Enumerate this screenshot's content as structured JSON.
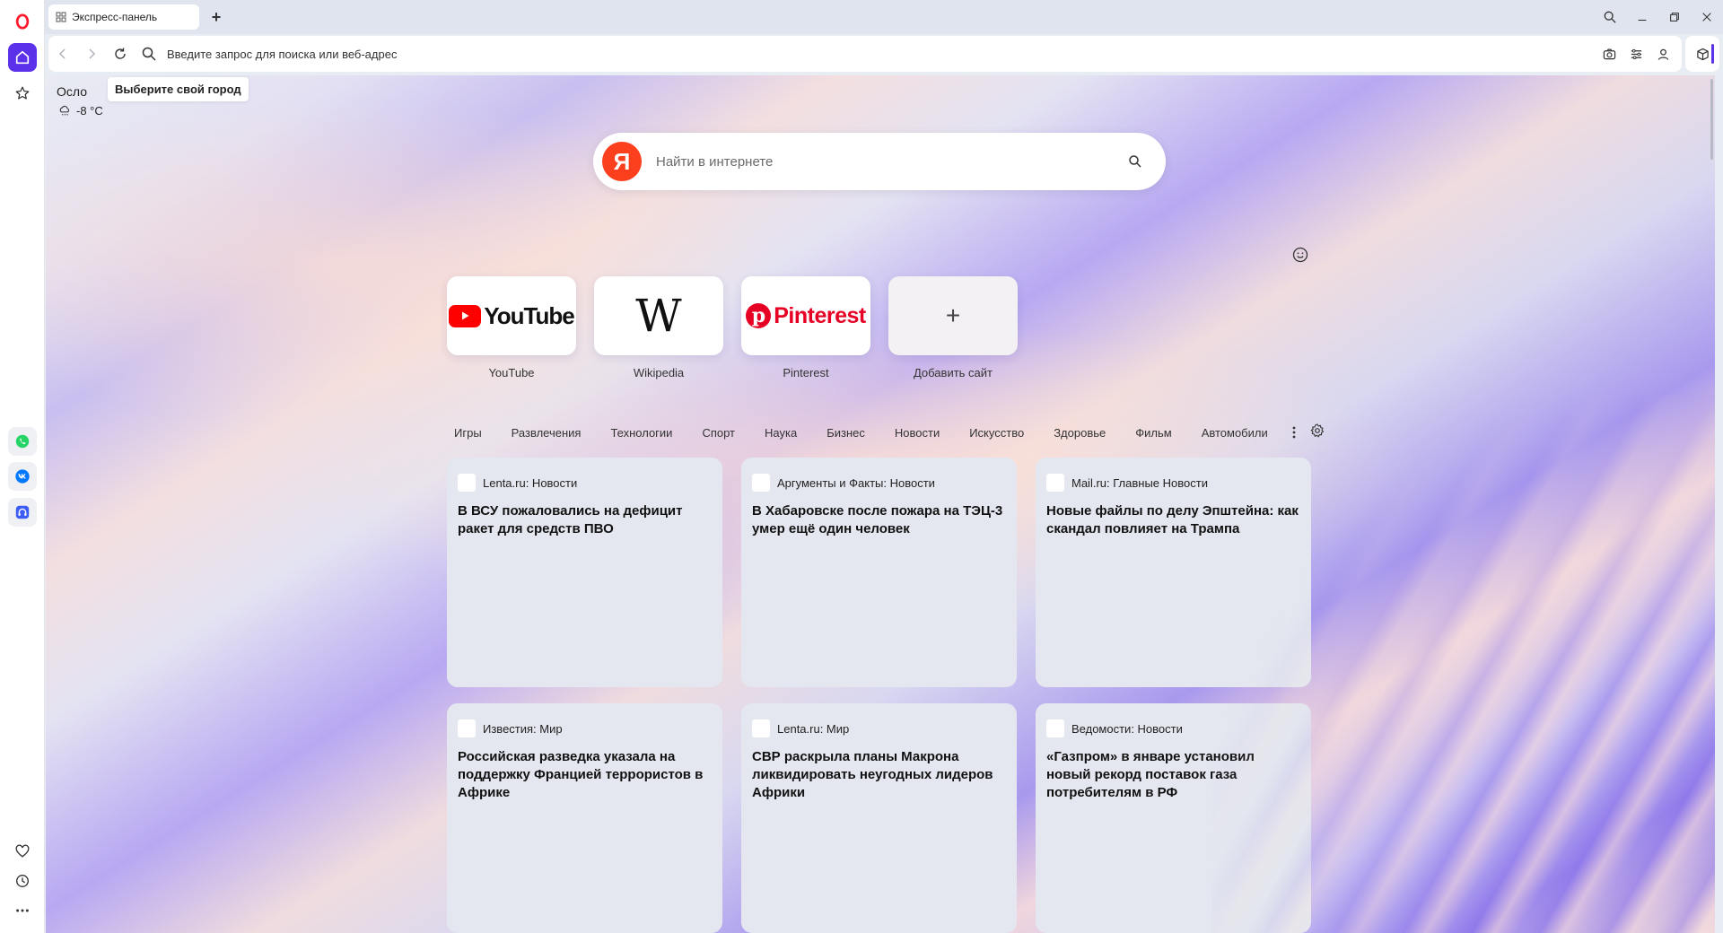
{
  "tab": {
    "title": "Экспресс-панель"
  },
  "address_bar": {
    "placeholder": "Введите запрос для поиска или веб-адрес"
  },
  "weather": {
    "city": "Осло",
    "tooltip": "Выберите свой город",
    "temperature": "-8 °C"
  },
  "search": {
    "placeholder": "Найти в интернете",
    "engine_letter": "Я"
  },
  "speed_dial": [
    {
      "label": "YouTube",
      "logo_text": "YouTube"
    },
    {
      "label": "Wikipedia",
      "logo_text": "W"
    },
    {
      "label": "Pinterest",
      "logo_text": "Pinterest"
    },
    {
      "label": "Добавить сайт",
      "logo_text": "+"
    }
  ],
  "categories": [
    "Игры",
    "Развлечения",
    "Технологии",
    "Спорт",
    "Наука",
    "Бизнес",
    "Новости",
    "Искусство",
    "Здоровье",
    "Фильм",
    "Автомобили"
  ],
  "news": [
    {
      "source": "Lenta.ru: Новости",
      "title": "В ВСУ пожаловались на дефицит ракет для средств ПВО"
    },
    {
      "source": "Аргументы и Факты: Новости",
      "title": "В Хабаровске после пожара на ТЭЦ-3 умер ещё один человек"
    },
    {
      "source": "Mail.ru: Главные Новости",
      "title": "Новые файлы по делу Эпштейна: как скандал повлияет на Трампа"
    },
    {
      "source": "Известия: Мир",
      "title": "Российская разведка указала на поддержку Францией террористов в Африке"
    },
    {
      "source": "Lenta.ru: Мир",
      "title": "СВР раскрыла планы Макрона ликвидировать неугодных лидеров Африки"
    },
    {
      "source": "Ведомости: Новости",
      "title": "«Газпром» в январе установил новый рекорд поставок газа потребителям в РФ"
    }
  ],
  "colors": {
    "accent": "#5c31ea",
    "opera_red": "#ff1b2d",
    "yandex_red": "#fc3f1d"
  },
  "icons": {
    "sidebar": [
      "opera-logo-icon",
      "home-icon",
      "star-icon",
      "whatsapp-icon",
      "vk-icon",
      "music-player-icon",
      "heart-icon",
      "history-icon",
      "more-icon"
    ],
    "toolbar": [
      "back-icon",
      "forward-icon",
      "reload-icon",
      "search-icon",
      "camera-icon",
      "easy-setup-icon",
      "profile-icon",
      "extensions-icon"
    ]
  }
}
